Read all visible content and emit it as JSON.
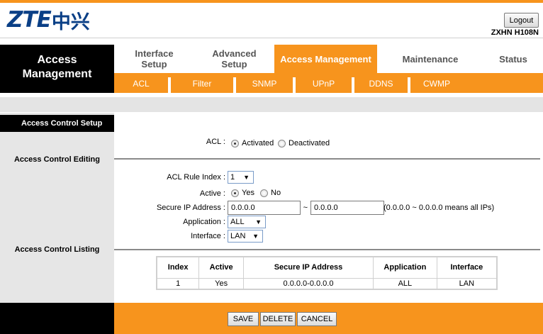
{
  "header": {
    "logo_latin": "ZTE",
    "logo_cn": "中兴",
    "logout_label": "Logout",
    "model": "ZXHN H108N"
  },
  "nav": {
    "section_title_line1": "Access",
    "section_title_line2": "Management",
    "tabs": [
      {
        "line1": "Interface",
        "line2": "Setup"
      },
      {
        "line1": "Advanced",
        "line2": "Setup"
      },
      {
        "line1": "Access Management",
        "line2": ""
      },
      {
        "line1": "Maintenance",
        "line2": ""
      },
      {
        "line1": "Status",
        "line2": ""
      }
    ],
    "active_tab": "Access Management",
    "subtabs": [
      "ACL",
      "Filter",
      "SNMP",
      "UPnP",
      "DDNS",
      "CWMP"
    ]
  },
  "sections": {
    "setup": "Access Control Setup",
    "editing": "Access Control Editing",
    "listing": "Access Control Listing"
  },
  "acl": {
    "label": "ACL :",
    "option_activated": "Activated",
    "option_deactivated": "Deactivated",
    "selected": "Activated"
  },
  "editing": {
    "rule_index_label": "ACL Rule Index :",
    "rule_index_value": "1",
    "active_label": "Active :",
    "active_yes": "Yes",
    "active_no": "No",
    "active_selected": "Yes",
    "secure_ip_label": "Secure IP Address :",
    "ip_start": "0.0.0.0",
    "ip_tilde": "~",
    "ip_end": "0.0.0.0",
    "ip_hint": "(0.0.0.0 ~ 0.0.0.0 means all IPs)",
    "application_label": "Application :",
    "application_value": "ALL",
    "interface_label": "Interface :",
    "interface_value": "LAN"
  },
  "listing": {
    "columns": [
      "Index",
      "Active",
      "Secure IP Address",
      "Application",
      "Interface"
    ],
    "rows": [
      [
        "1",
        "Yes",
        "0.0.0.0-0.0.0.0",
        "ALL",
        "LAN"
      ]
    ]
  },
  "footer": {
    "save_label": "SAVE",
    "delete_label": "DELETE",
    "cancel_label": "CANCEL"
  },
  "colors": {
    "accent_orange": "#f7941d",
    "logo_blue": "#0a3f86"
  }
}
